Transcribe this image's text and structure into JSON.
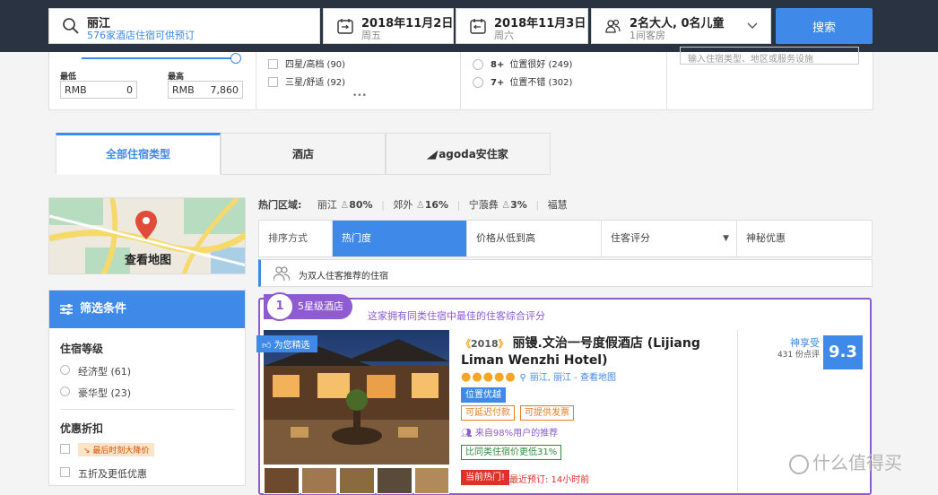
{
  "search": {
    "destination": "丽江",
    "destination_sub": "576家酒店住宿可供预订",
    "checkin": "2018年11月2日",
    "checkin_day": "周五",
    "checkout": "2018年11月3日",
    "checkout_day": "周六",
    "guests": "2名大人, 0名儿童",
    "rooms": "1间客房",
    "search_label": "搜索"
  },
  "price": {
    "min_label": "最低",
    "max_label": "最高",
    "currency": "RMB",
    "min_value": "0",
    "max_value": "7,860"
  },
  "star_filters": [
    {
      "label": "四星/高档 (90)"
    },
    {
      "label": "三星/舒适 (92)"
    }
  ],
  "more_dots": "•••",
  "review_filters": [
    {
      "score": "8+",
      "label": "位置很好 (249)"
    },
    {
      "score": "7+",
      "label": "位置不错 (302)"
    }
  ],
  "keyword_placeholder": "输入住宿类型、地区或服务设施",
  "tabs": [
    {
      "label": "全部住宿类型"
    },
    {
      "label": "酒店"
    },
    {
      "label": "agoda安住家"
    }
  ],
  "map": {
    "label": "查看地图"
  },
  "filter_panel": {
    "title": "筛选条件",
    "section1": "住宿等级",
    "options1": [
      {
        "label": "经济型 (61)"
      },
      {
        "label": "豪华型 (23)"
      }
    ],
    "section2": "优惠折扣",
    "deal1": "最后时刻大降价",
    "deal2": "五折及更低优惠"
  },
  "hot_areas": {
    "label": "热门区域:",
    "items": [
      {
        "name": "丽江",
        "pct": "80%"
      },
      {
        "name": "郊外",
        "pct": "16%"
      },
      {
        "name": "宁蒗彝",
        "pct": "3%"
      }
    ],
    "extra": "福慧"
  },
  "sort": {
    "label": "排序方式",
    "options": [
      "热门度",
      "价格从低到高",
      "住客评分",
      "神秘优惠"
    ]
  },
  "recommend_text": "为双人住客推荐的住宿",
  "hotel": {
    "badge_num": "1",
    "badge_text": "5星级酒店",
    "badge_desc": "这家拥有同类住宿中最佳的住客综合评分",
    "picked": "为您精选",
    "year": "2018",
    "name": "丽镘.文治一号度假酒店 (Lijiang Liman Wenzhi Hotel)",
    "location": "丽江, 丽江 - 查看地图",
    "loc_tag": "位置优越",
    "tag1": "可延迟付款",
    "tag2": "可提供发票",
    "recommend": "来自98%用户的推荐",
    "compare": "比同类住宿价更低31%",
    "hot": "当前热门!",
    "recent": "最近预订: 14小时前",
    "score_label": "神享受",
    "reviews": "431 份点评",
    "score": "9.3"
  },
  "watermark": "什么值得买",
  "colors": {
    "accent": "#3f8ae8",
    "topbar": "#2a3342",
    "purple": "#8e5bd0",
    "orange": "#f6a623"
  }
}
